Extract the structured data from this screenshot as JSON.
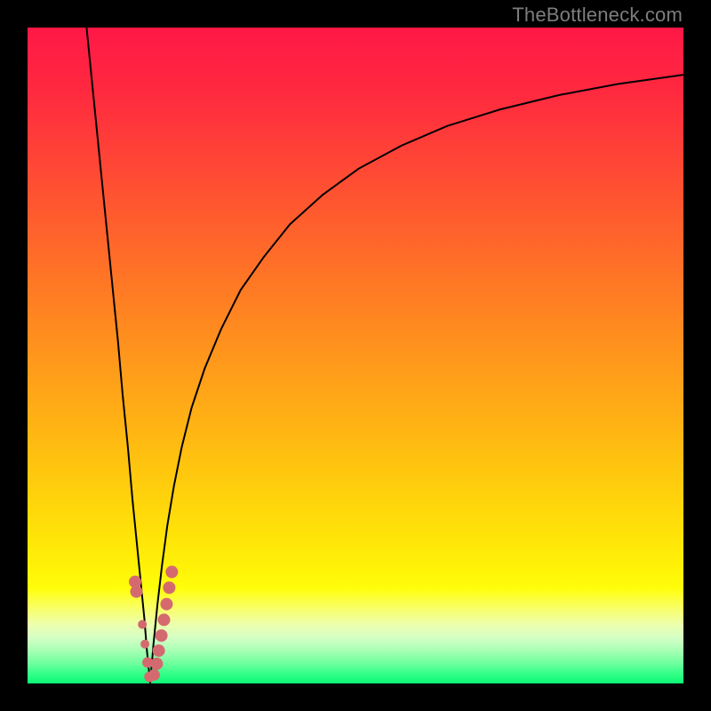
{
  "watermark": {
    "text": "TheBottleneck.com"
  },
  "gradient": {
    "stops": [
      {
        "offset": 0.0,
        "color": "#ff1846"
      },
      {
        "offset": 0.1,
        "color": "#ff2a3f"
      },
      {
        "offset": 0.2,
        "color": "#ff4436"
      },
      {
        "offset": 0.3,
        "color": "#ff5f2d"
      },
      {
        "offset": 0.4,
        "color": "#ff7a24"
      },
      {
        "offset": 0.5,
        "color": "#ff961c"
      },
      {
        "offset": 0.6,
        "color": "#ffb114"
      },
      {
        "offset": 0.68,
        "color": "#ffc80e"
      },
      {
        "offset": 0.76,
        "color": "#ffdf09"
      },
      {
        "offset": 0.82,
        "color": "#fff107"
      },
      {
        "offset": 0.855,
        "color": "#fffe0a"
      },
      {
        "offset": 0.865,
        "color": "#feff2a"
      },
      {
        "offset": 0.88,
        "color": "#faff57"
      },
      {
        "offset": 0.895,
        "color": "#f4ff83"
      },
      {
        "offset": 0.91,
        "color": "#ecffad"
      },
      {
        "offset": 0.93,
        "color": "#d5ffc4"
      },
      {
        "offset": 0.95,
        "color": "#a7ffb5"
      },
      {
        "offset": 0.97,
        "color": "#6cff9d"
      },
      {
        "offset": 0.985,
        "color": "#34ff87"
      },
      {
        "offset": 1.0,
        "color": "#0cf776"
      }
    ]
  },
  "chart_data": {
    "type": "line",
    "title": "",
    "xlabel": "",
    "ylabel": "",
    "xlim": [
      0,
      100
    ],
    "ylim": [
      0,
      100
    ],
    "curve_left": {
      "x": [
        9.0,
        9.8,
        10.6,
        11.4,
        12.2,
        13.0,
        13.8,
        14.5,
        15.3,
        16.0,
        16.6,
        17.2,
        17.8,
        18.2,
        18.7
      ],
      "y": [
        100,
        92,
        84,
        76,
        68,
        60,
        52,
        44,
        36,
        28,
        22,
        16,
        10,
        5,
        0
      ]
    },
    "curve_right": {
      "x": [
        18.7,
        19.2,
        19.8,
        20.5,
        21.3,
        22.3,
        23.5,
        25.0,
        27.0,
        29.5,
        32.5,
        36.0,
        40.0,
        45.0,
        50.5,
        57.0,
        64.0,
        72.0,
        81.0,
        90.0,
        100.0
      ],
      "y": [
        0,
        6,
        12,
        18,
        24,
        30,
        36,
        42,
        48,
        54,
        60,
        65,
        70,
        74.5,
        78.5,
        82,
        85,
        87.5,
        89.7,
        91.4,
        92.8
      ]
    },
    "dots_left": {
      "color": "#d46a6f",
      "points": [
        {
          "x": 16.4,
          "y": 15.5,
          "r": 7
        },
        {
          "x": 16.6,
          "y": 14.0,
          "r": 7
        },
        {
          "x": 17.5,
          "y": 9.0,
          "r": 5
        },
        {
          "x": 17.9,
          "y": 6.0,
          "r": 5
        },
        {
          "x": 18.3,
          "y": 3.2,
          "r": 6
        },
        {
          "x": 18.6,
          "y": 1.0,
          "r": 6
        }
      ]
    },
    "dots_right": {
      "color": "#d46a6f",
      "points": [
        {
          "x": 19.3,
          "y": 1.3,
          "r": 6.5
        },
        {
          "x": 19.7,
          "y": 3.0,
          "r": 7
        },
        {
          "x": 20.0,
          "y": 5.0,
          "r": 7
        },
        {
          "x": 20.4,
          "y": 7.3,
          "r": 7
        },
        {
          "x": 20.8,
          "y": 9.7,
          "r": 7
        },
        {
          "x": 21.2,
          "y": 12.1,
          "r": 7
        },
        {
          "x": 21.6,
          "y": 14.6,
          "r": 7
        },
        {
          "x": 22.0,
          "y": 17.0,
          "r": 7
        }
      ]
    }
  }
}
